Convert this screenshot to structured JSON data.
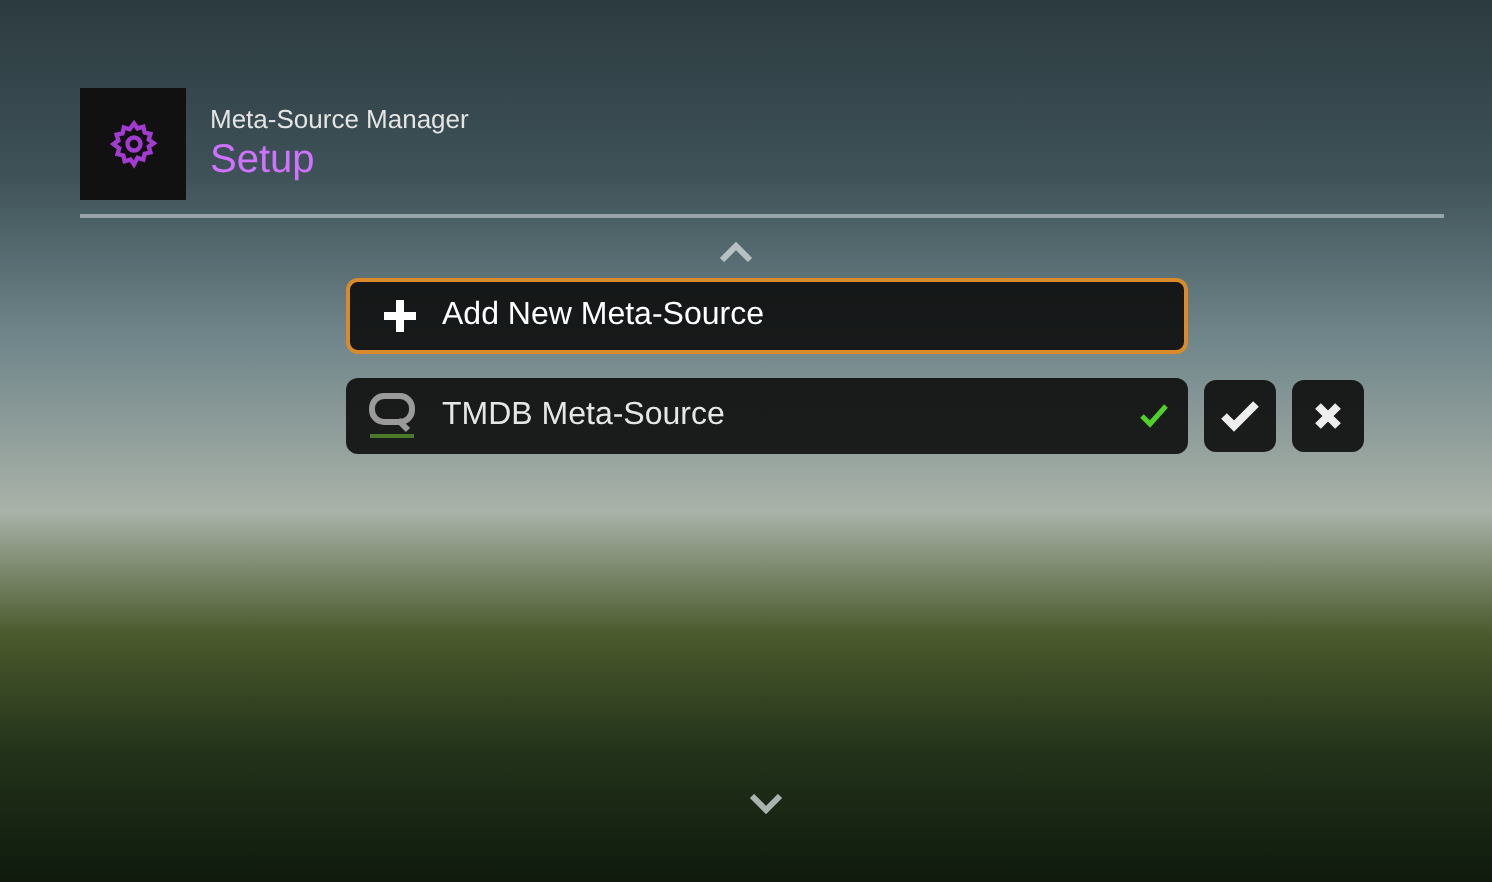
{
  "header": {
    "title": "Meta-Source Manager",
    "subtitle": "Setup"
  },
  "items": [
    {
      "kind": "add",
      "label": "Add New Meta-Source",
      "focused": true
    },
    {
      "kind": "source",
      "label": "TMDB Meta-Source",
      "focused": false,
      "enabled": true
    }
  ]
}
